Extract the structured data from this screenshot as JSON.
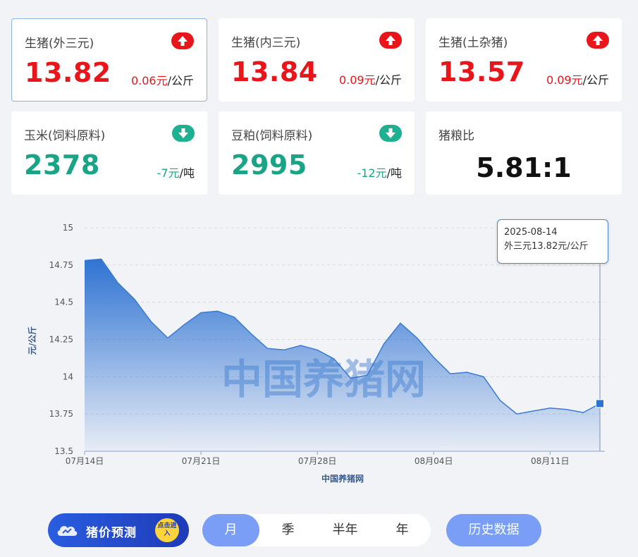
{
  "cards": [
    {
      "title": "生猪(外三元)",
      "value": "13.82",
      "change": "0.06元",
      "unit": "/公斤",
      "trend": "up"
    },
    {
      "title": "生猪(内三元)",
      "value": "13.84",
      "change": "0.09元",
      "unit": "/公斤",
      "trend": "up"
    },
    {
      "title": "生猪(土杂猪)",
      "value": "13.57",
      "change": "0.09元",
      "unit": "/公斤",
      "trend": "up"
    },
    {
      "title": "玉米(饲料原料)",
      "value": "2378",
      "change": "-7元",
      "unit": "/吨",
      "trend": "down"
    },
    {
      "title": "豆粕(饲料原料)",
      "value": "2995",
      "change": "-12元",
      "unit": "/吨",
      "trend": "down"
    },
    {
      "title": "猪粮比",
      "value": "5.81:1"
    }
  ],
  "colors": {
    "up": "#e8161b",
    "down": "#19a585",
    "line": "#3a7ad0",
    "accent": "#7a9ef5"
  },
  "chart_data": {
    "type": "area",
    "x": [
      "2025-07-14",
      "2025-07-15",
      "2025-07-16",
      "2025-07-17",
      "2025-07-18",
      "2025-07-19",
      "2025-07-20",
      "2025-07-21",
      "2025-07-22",
      "2025-07-23",
      "2025-07-24",
      "2025-07-25",
      "2025-07-26",
      "2025-07-27",
      "2025-07-28",
      "2025-07-29",
      "2025-07-30",
      "2025-07-31",
      "2025-08-01",
      "2025-08-02",
      "2025-08-03",
      "2025-08-04",
      "2025-08-05",
      "2025-08-06",
      "2025-08-07",
      "2025-08-08",
      "2025-08-09",
      "2025-08-10",
      "2025-08-11",
      "2025-08-12",
      "2025-08-13",
      "2025-08-14"
    ],
    "values": [
      14.78,
      14.79,
      14.63,
      14.52,
      14.37,
      14.26,
      14.35,
      14.43,
      14.44,
      14.4,
      14.29,
      14.19,
      14.18,
      14.21,
      14.18,
      14.12,
      13.99,
      14.01,
      14.22,
      14.36,
      14.26,
      14.13,
      14.02,
      14.03,
      14.0,
      13.84,
      13.75,
      13.77,
      13.79,
      13.78,
      13.76,
      13.82
    ],
    "ylabel": "元/公斤",
    "xlabel": "中国养猪网",
    "ylim": [
      13.5,
      15
    ],
    "yticks": [
      13.5,
      13.75,
      14,
      14.25,
      14.5,
      14.75,
      15
    ],
    "xticks": [
      {
        "date": "2025-07-14",
        "label": "07月14日"
      },
      {
        "date": "2025-07-21",
        "label": "07月21日"
      },
      {
        "date": "2025-07-28",
        "label": "07月28日"
      },
      {
        "date": "2025-08-04",
        "label": "08月04日"
      },
      {
        "date": "2025-08-11",
        "label": "08月11日"
      }
    ],
    "grid": true,
    "watermark": "中国养猪网",
    "tooltip": {
      "date": "2025-08-14",
      "text": "外三元13.82元/公斤"
    }
  },
  "controls": {
    "promo_label": "猪价预测",
    "promo_badge": "点击进入",
    "periods": [
      "月",
      "季",
      "半年",
      "年"
    ],
    "selected_period": "月",
    "history_label": "历史数据"
  }
}
